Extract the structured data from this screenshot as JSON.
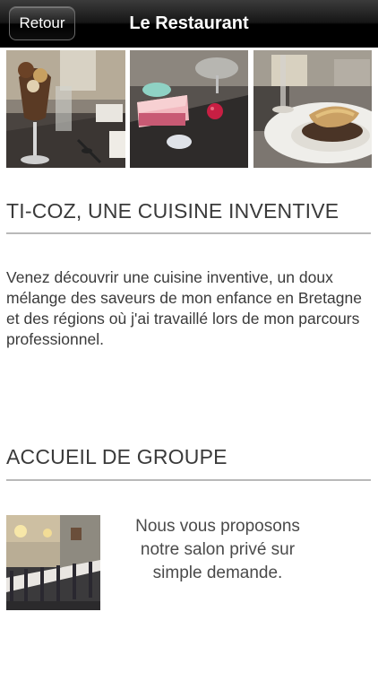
{
  "navbar": {
    "back_label": "Retour",
    "title": "Le Restaurant"
  },
  "gallery": {
    "photos": [
      "dessert-glass-photo",
      "pink-cake-photo",
      "fish-plate-photo"
    ]
  },
  "section1": {
    "title": "TI-COZ, UNE CUISINE INVENTIVE",
    "text": "Venez découvrir une cuisine inventive, un doux mélange des saveurs de mon enfance en Bretagne et des régions où j'ai travaillé lors de mon parcours professionnel."
  },
  "section2": {
    "title": "ACCUEIL DE GROUPE",
    "photo": "private-dining-room-photo",
    "text": "Nous vous proposons notre salon privé sur simple demande."
  },
  "colors": {
    "navbar": "#000000",
    "text": "#3a3a3a",
    "rule": "#b9b9b9"
  }
}
